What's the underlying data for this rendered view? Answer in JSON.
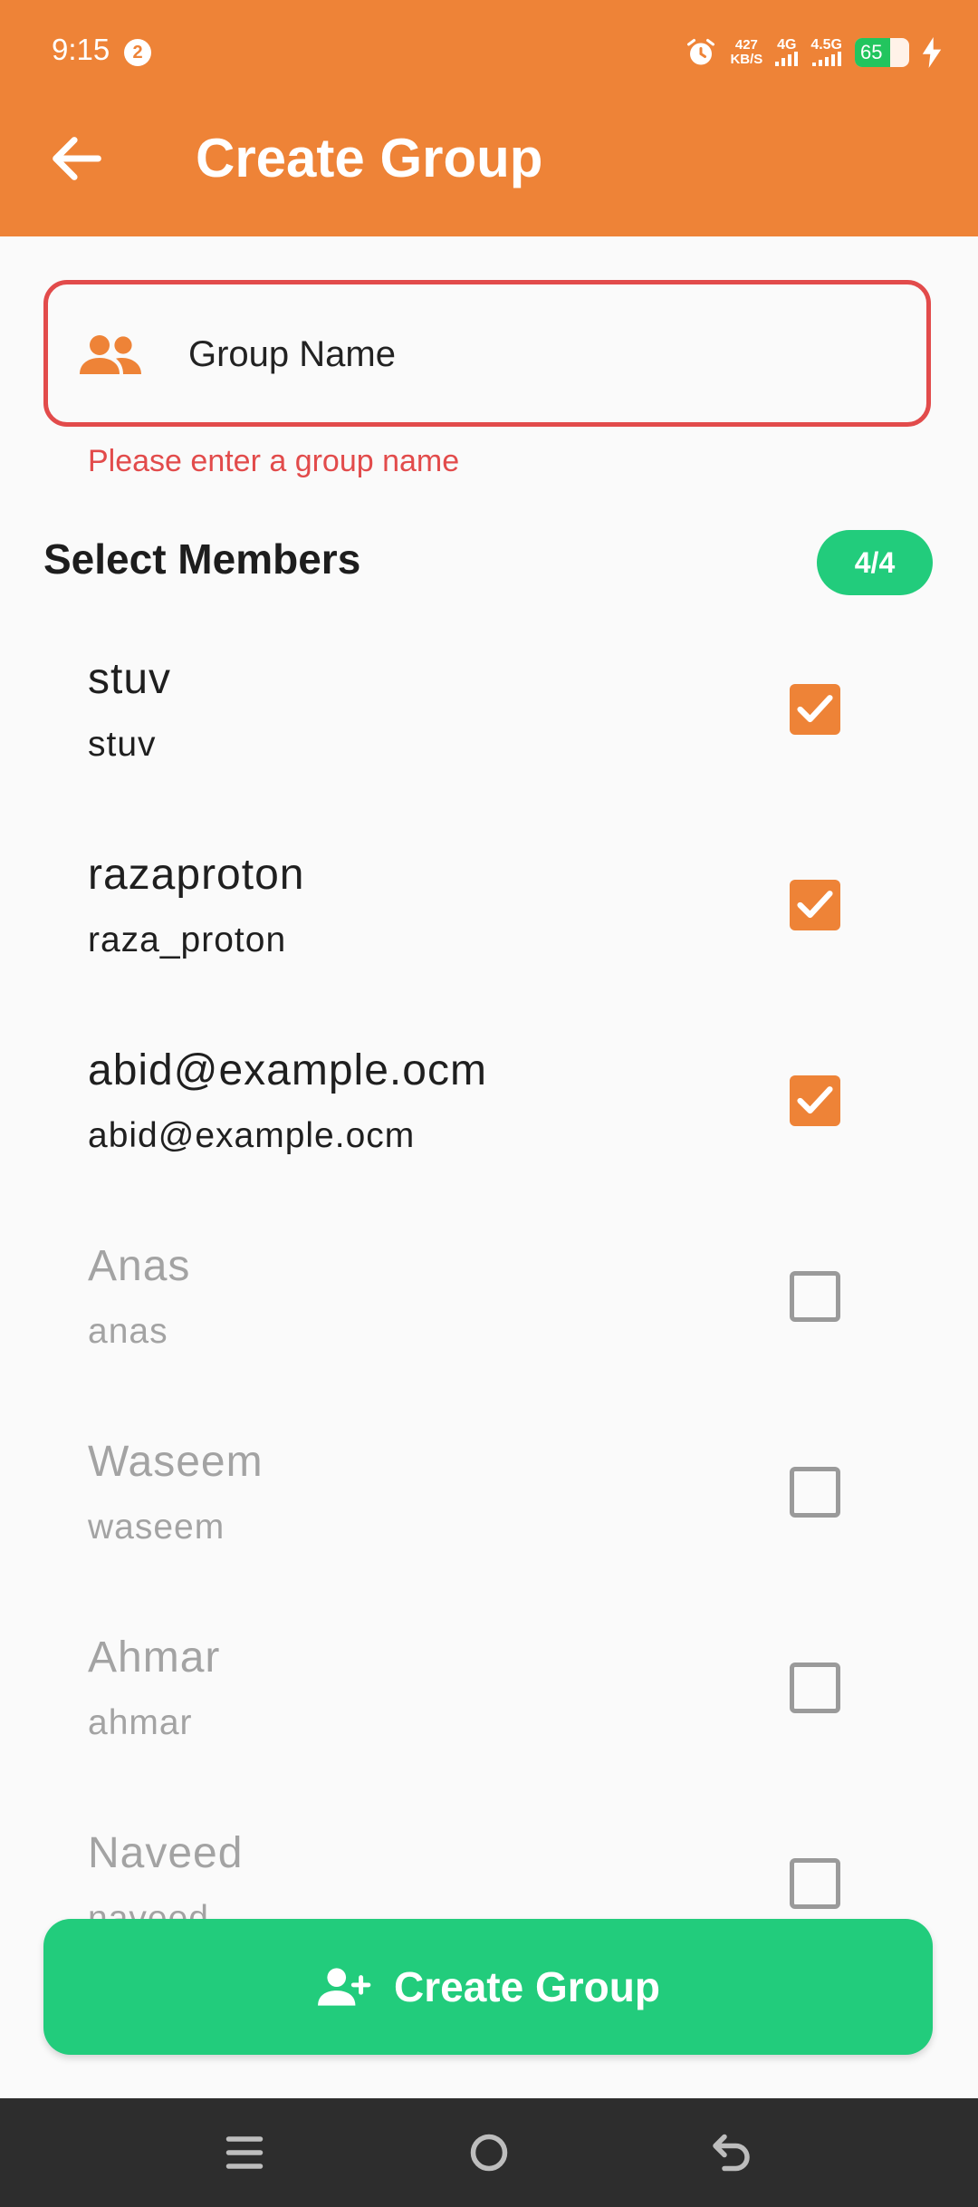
{
  "status_bar": {
    "time": "9:15",
    "notification_count": "2",
    "net_speed_value": "427",
    "net_speed_unit": "KB/S",
    "network_1": "4G",
    "network_2": "4.5G",
    "battery_level": "65",
    "battery_fraction": 0.65
  },
  "app_bar": {
    "title": "Create Group",
    "back_icon": "arrow-left-icon"
  },
  "group_name": {
    "placeholder": "Group Name",
    "icon": "group-icon",
    "error": "Please enter a group name"
  },
  "members_section": {
    "title": "Select Members",
    "count": "4/4"
  },
  "members": [
    {
      "name": "stuv",
      "handle": "stuv",
      "checked": true
    },
    {
      "name": "razaproton",
      "handle": "raza_proton",
      "checked": true
    },
    {
      "name": "abid@example.ocm",
      "handle": "abid@example.ocm",
      "checked": true
    },
    {
      "name": "Anas",
      "handle": "anas",
      "checked": false
    },
    {
      "name": "Waseem",
      "handle": "waseem",
      "checked": false
    },
    {
      "name": "Ahmar",
      "handle": "ahmar",
      "checked": false
    },
    {
      "name": "Naveed",
      "handle": "naveed",
      "checked": false
    }
  ],
  "create_button": {
    "label": "Create Group",
    "icon": "add-person-icon"
  },
  "colors": {
    "primary": "#ee8337",
    "success": "#22cc7c",
    "error": "#e24b4b"
  }
}
